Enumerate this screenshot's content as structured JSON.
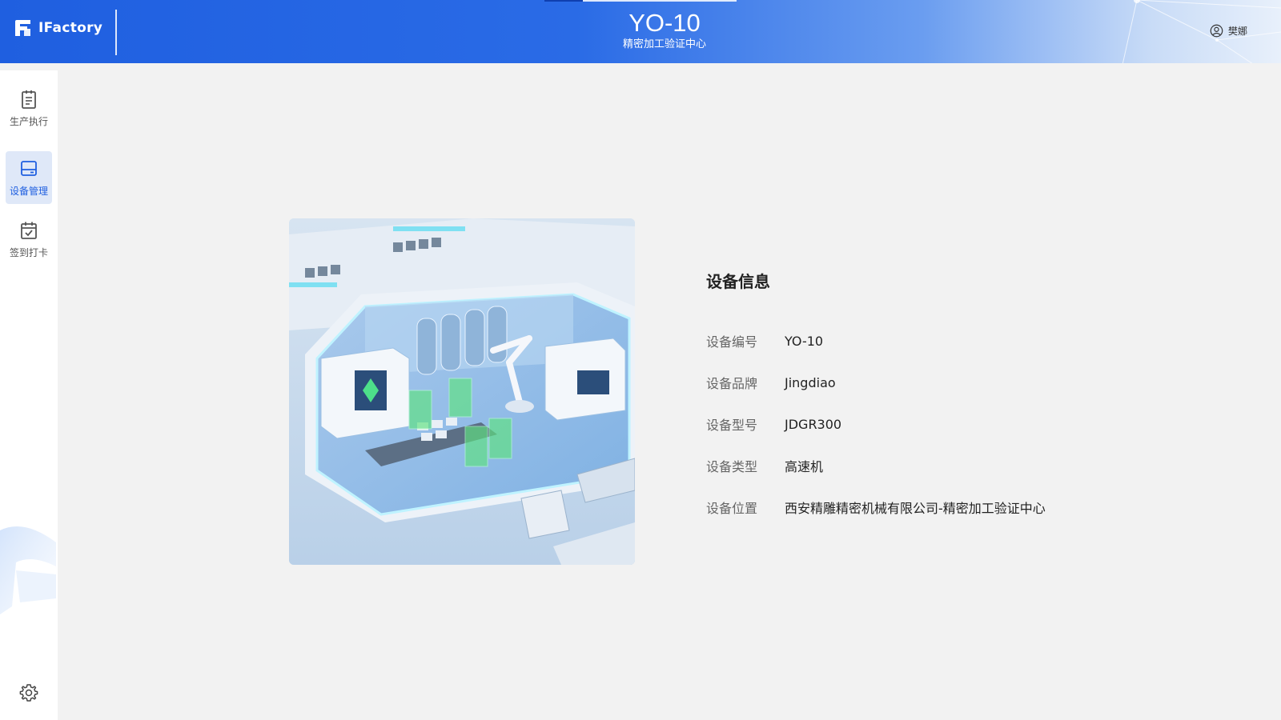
{
  "header": {
    "brand": "IFactory",
    "title": "YO-10",
    "subtitle": "精密加工验证中心",
    "user_name": "樊娜"
  },
  "sidebar": {
    "items": [
      {
        "label": "生产执行",
        "icon": "clipboard-icon",
        "active": false
      },
      {
        "label": "设备管理",
        "icon": "device-icon",
        "active": true
      },
      {
        "label": "签到打卡",
        "icon": "calendar-check-icon",
        "active": false
      }
    ],
    "settings_icon": "gear-icon"
  },
  "device_info": {
    "title": "设备信息",
    "fields": [
      {
        "label": "设备编号",
        "value": "YO-10"
      },
      {
        "label": "设备品牌",
        "value": "Jingdiao"
      },
      {
        "label": "设备型号",
        "value": "JDGR300"
      },
      {
        "label": "设备类型",
        "value": "高速机"
      },
      {
        "label": "设备位置",
        "value": "西安精雕精密机械有限公司-精密加工验证中心"
      }
    ]
  },
  "colors": {
    "primary": "#1f5fe0",
    "active_bg": "#dfe8f8",
    "page_bg": "#f2f2f2"
  }
}
